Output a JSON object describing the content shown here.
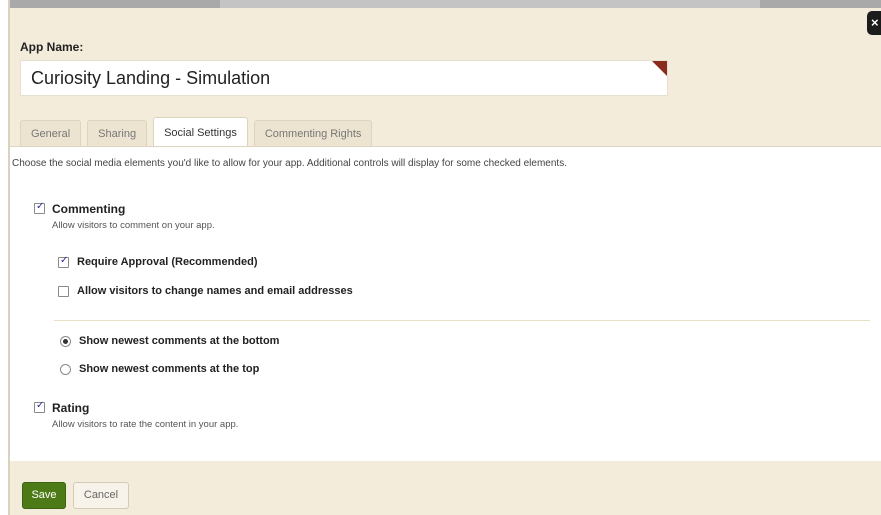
{
  "app_name": {
    "label": "App Name:",
    "value": "Curiosity Landing - Simulation"
  },
  "close_label": "×",
  "tabs": [
    {
      "label": "General",
      "active": false
    },
    {
      "label": "Sharing",
      "active": false
    },
    {
      "label": "Social Settings",
      "active": true
    },
    {
      "label": "Commenting Rights",
      "active": false
    }
  ],
  "intro": "Choose the social media elements you'd like to allow for your app. Additional controls will display for some checked elements.",
  "commenting": {
    "label": "Commenting",
    "checked": true,
    "description": "Allow visitors to comment on your app.",
    "require_approval": {
      "label": "Require Approval (Recommended)",
      "checked": true
    },
    "allow_change_names": {
      "label": "Allow visitors to change names and email addresses",
      "checked": false
    },
    "order_options": [
      {
        "label": "Show newest comments at the bottom",
        "selected": true
      },
      {
        "label": "Show newest comments at the top",
        "selected": false
      }
    ]
  },
  "rating": {
    "label": "Rating",
    "checked": true,
    "description": "Allow visitors to rate the content in your app."
  },
  "footer": {
    "save_label": "Save",
    "cancel_label": "Cancel"
  },
  "colors": {
    "frame_bg": "#f3ecdb",
    "save_green": "#4c7a16",
    "corner_flag": "#8a2b1e"
  }
}
